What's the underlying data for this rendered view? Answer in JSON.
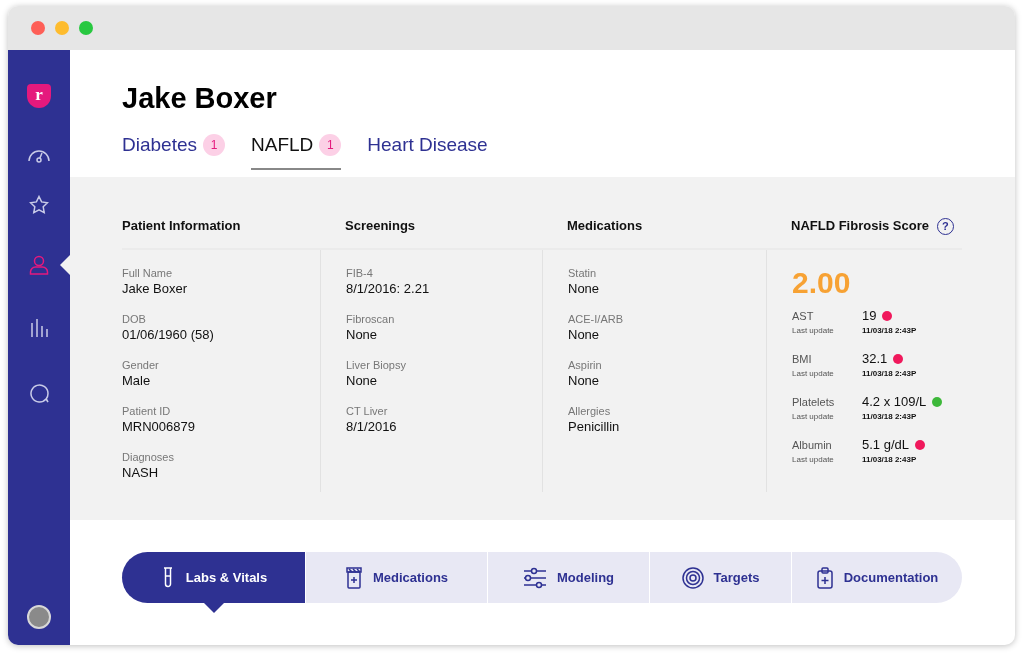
{
  "logo": {
    "text": "r"
  },
  "sidebar": {
    "items": [
      {
        "selected": false
      },
      {
        "selected": false
      },
      {
        "selected": true
      },
      {
        "selected": false
      },
      {
        "selected": false
      }
    ]
  },
  "patient": {
    "name": "Jake Boxer"
  },
  "tabs": [
    {
      "label": "Diabetes",
      "badge": "1",
      "selected": false
    },
    {
      "label": "NAFLD",
      "badge": "1",
      "selected": true
    },
    {
      "label": "Heart Disease",
      "selected": false
    }
  ],
  "sections": [
    {
      "title": "Patient Information",
      "fields": [
        {
          "label": "Full Name",
          "value": "Jake Boxer"
        },
        {
          "label": "DOB",
          "value": "01/06/1960 (58)"
        },
        {
          "label": "Gender",
          "value": "Male"
        },
        {
          "label": "Patient ID",
          "value": "MRN006879"
        },
        {
          "label": "Diagnoses",
          "value": "NASH"
        }
      ]
    },
    {
      "title": "Screenings",
      "fields": [
        {
          "label": "FIB-4",
          "value": "8/1/2016: 2.21"
        },
        {
          "label": "Fibroscan",
          "value": "None"
        },
        {
          "label": "Liver Biopsy",
          "value": "None"
        },
        {
          "label": "CT Liver",
          "value": "8/1/2016"
        }
      ]
    },
    {
      "title": "Medications",
      "fields": [
        {
          "label": "Statin",
          "value": "None"
        },
        {
          "label": "ACE-I/ARB",
          "value": "None"
        },
        {
          "label": "Aspirin",
          "value": "None"
        },
        {
          "label": "Allergies",
          "value": "Penicillin"
        }
      ]
    }
  ],
  "fibrosis_score": {
    "title": "NAFLD Fibrosis Score",
    "help": "?",
    "score": "2.00",
    "labs": [
      {
        "name": "AST",
        "value": "19",
        "note": "Last update",
        "updated": "11/03/18 2:43P",
        "color": "#f0195c"
      },
      {
        "name": "BMI",
        "value": "32.1",
        "note": "Last update",
        "updated": "11/03/18 2:43P",
        "color": "#f0195c"
      },
      {
        "name": "Platelets",
        "value": "4.2 x 109/L",
        "note": "Last update",
        "updated": "11/03/18 2:43P",
        "color": "#3db83a"
      },
      {
        "name": "Albumin",
        "value": "5.1 g/dL",
        "note": "Last update",
        "updated": "11/03/18 2:43P",
        "color": "#f0195c"
      }
    ]
  },
  "bottom_nav": [
    {
      "label": "Labs & Vitals",
      "selected": true
    },
    {
      "label": "Medications",
      "selected": false
    },
    {
      "label": "Modeling",
      "selected": false
    },
    {
      "label": "Targets",
      "selected": false
    },
    {
      "label": "Documentation",
      "selected": false
    }
  ]
}
